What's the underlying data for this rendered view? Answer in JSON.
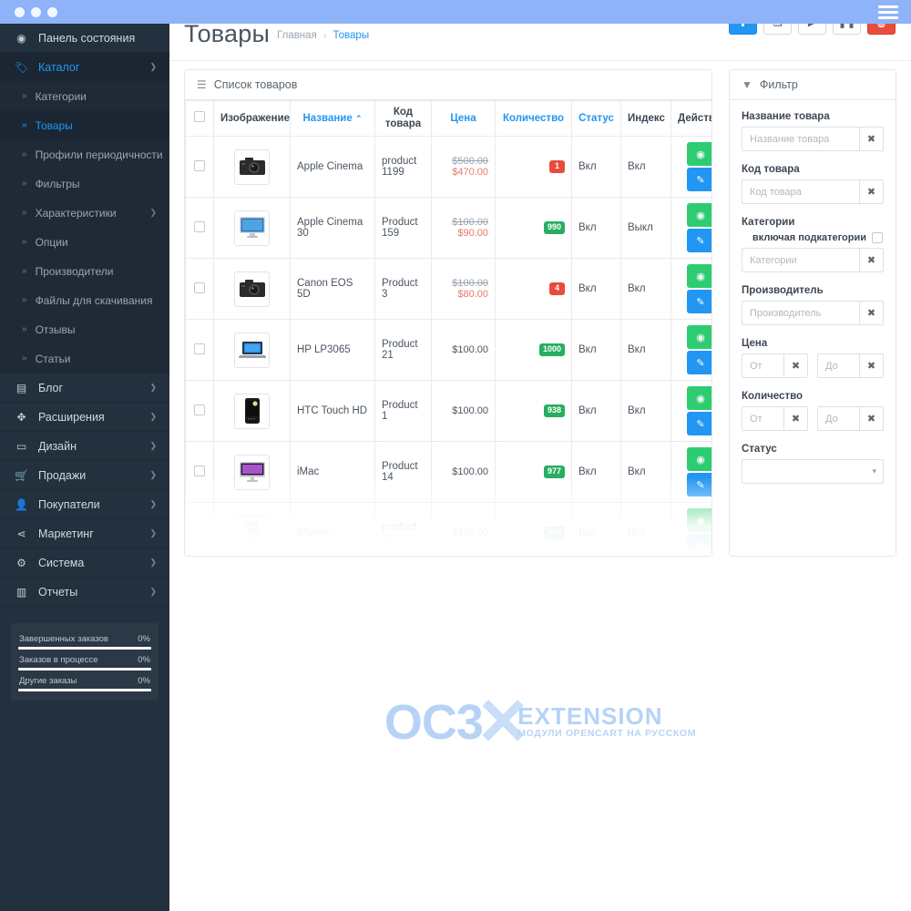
{
  "chrome": {
    "hamburger_icon": "hamburger-icon",
    "dots": [
      "dot",
      "dot",
      "dot"
    ]
  },
  "header": {
    "title": "Товары",
    "breadcrumb": {
      "home": "Главная",
      "separator": "›",
      "current": "Товары"
    }
  },
  "toolbar": {
    "buttons": [
      {
        "name": "add-new-button",
        "icon": "plus-icon",
        "glyph": "✚",
        "style": "primary"
      },
      {
        "name": "copy-button",
        "icon": "copy-icon",
        "glyph": "❏",
        "style": "default"
      },
      {
        "name": "enable-button",
        "icon": "play-icon",
        "glyph": "▶",
        "style": "default"
      },
      {
        "name": "disable-button",
        "icon": "pause-icon",
        "glyph": "❚❚",
        "style": "default"
      },
      {
        "name": "delete-button",
        "icon": "trash-icon",
        "glyph": "🗑",
        "style": "danger"
      }
    ]
  },
  "sidebar": {
    "items": [
      {
        "label": "Панель состояния",
        "icon": "dashboard-icon",
        "glyph": "◉",
        "has_caret": false,
        "active": false,
        "level": 0
      },
      {
        "label": "Каталог",
        "icon": "tag-icon",
        "glyph": "🏷",
        "has_caret": true,
        "active": true,
        "level": 0
      },
      {
        "label": "Категории",
        "icon": "chevron-right-icon",
        "has_caret": false,
        "active": false,
        "level": 1
      },
      {
        "label": "Товары",
        "icon": "chevron-right-icon",
        "has_caret": false,
        "active": true,
        "level": 1
      },
      {
        "label": "Профили периодичности",
        "icon": "chevron-right-icon",
        "has_caret": false,
        "active": false,
        "level": 1
      },
      {
        "label": "Фильтры",
        "icon": "chevron-right-icon",
        "has_caret": false,
        "active": false,
        "level": 1
      },
      {
        "label": "Характеристики",
        "icon": "chevron-right-icon",
        "has_caret": true,
        "active": false,
        "level": 1
      },
      {
        "label": "Опции",
        "icon": "chevron-right-icon",
        "has_caret": false,
        "active": false,
        "level": 1
      },
      {
        "label": "Производители",
        "icon": "chevron-right-icon",
        "has_caret": false,
        "active": false,
        "level": 1
      },
      {
        "label": "Файлы для скачивания",
        "icon": "chevron-right-icon",
        "has_caret": false,
        "active": false,
        "level": 1
      },
      {
        "label": "Отзывы",
        "icon": "chevron-right-icon",
        "has_caret": false,
        "active": false,
        "level": 1
      },
      {
        "label": "Статьи",
        "icon": "chevron-right-icon",
        "has_caret": false,
        "active": false,
        "level": 1
      },
      {
        "label": "Блог",
        "icon": "book-icon",
        "glyph": "▤",
        "has_caret": true,
        "active": false,
        "level": 0
      },
      {
        "label": "Расширения",
        "icon": "puzzle-icon",
        "glyph": "✥",
        "has_caret": true,
        "active": false,
        "level": 0
      },
      {
        "label": "Дизайн",
        "icon": "monitor-icon",
        "glyph": "▭",
        "has_caret": true,
        "active": false,
        "level": 0
      },
      {
        "label": "Продажи",
        "icon": "cart-icon",
        "glyph": "🛒",
        "has_caret": true,
        "active": false,
        "level": 0
      },
      {
        "label": "Покупатели",
        "icon": "user-icon",
        "glyph": "👤",
        "has_caret": true,
        "active": false,
        "level": 0
      },
      {
        "label": "Маркетинг",
        "icon": "share-icon",
        "glyph": "⋖",
        "has_caret": true,
        "active": false,
        "level": 0
      },
      {
        "label": "Система",
        "icon": "gear-icon",
        "glyph": "⚙",
        "has_caret": true,
        "active": false,
        "level": 0
      },
      {
        "label": "Отчеты",
        "icon": "chart-bar-icon",
        "glyph": "▥",
        "has_caret": true,
        "active": false,
        "level": 0
      }
    ],
    "stats": [
      {
        "label": "Завершенных заказов",
        "value": "0%",
        "percent": 100
      },
      {
        "label": "Заказов в процессе",
        "value": "0%",
        "percent": 100
      },
      {
        "label": "Другие заказы",
        "value": "0%",
        "percent": 100
      }
    ]
  },
  "products_panel": {
    "title": "Список товаров",
    "icon": "list-icon",
    "columns": [
      {
        "label": "",
        "blue": false,
        "name": "select-all"
      },
      {
        "label": "Изображение",
        "blue": false,
        "name": "image"
      },
      {
        "label": "Название",
        "blue": true,
        "name": "name",
        "sorted": "asc",
        "sort_arrow": "⌃"
      },
      {
        "label": "Код товара",
        "blue": false,
        "name": "model"
      },
      {
        "label": "Цена",
        "blue": true,
        "name": "price"
      },
      {
        "label": "Количество",
        "blue": true,
        "name": "quantity"
      },
      {
        "label": "Статус",
        "blue": true,
        "name": "status"
      },
      {
        "label": "Индекс",
        "blue": false,
        "name": "index"
      },
      {
        "label": "Действие",
        "blue": false,
        "name": "action"
      }
    ],
    "rows": [
      {
        "image": "camera",
        "name": "Apple Cinema",
        "code": "product 1199",
        "price_old": "$500.00",
        "price_new": "$470.00",
        "price": "",
        "qty": "1",
        "qty_color": "red",
        "status": "Вкл",
        "index": "Вкл"
      },
      {
        "image": "monitor",
        "name": "Apple Cinema 30",
        "code": "Product 159",
        "price_old": "$100.00",
        "price_new": "$90.00",
        "price": "",
        "qty": "990",
        "qty_color": "green",
        "status": "Вкл",
        "index": "Выкл"
      },
      {
        "image": "camera",
        "name": "Canon EOS 5D",
        "code": "Product 3",
        "price_old": "$100.00",
        "price_new": "$80.00",
        "price": "",
        "qty": "4",
        "qty_color": "red",
        "status": "Вкл",
        "index": "Вкл"
      },
      {
        "image": "laptop",
        "name": "HP LP3065",
        "code": "Product 21",
        "price_old": "",
        "price_new": "",
        "price": "$100.00",
        "qty": "1000",
        "qty_color": "green",
        "status": "Вкл",
        "index": "Вкл"
      },
      {
        "image": "phone",
        "name": "HTC Touch HD",
        "code": "Product 1",
        "price_old": "",
        "price_new": "",
        "price": "$100.00",
        "qty": "938",
        "qty_color": "green",
        "status": "Вкл",
        "index": "Вкл"
      },
      {
        "image": "imac",
        "name": "iMac",
        "code": "Product 14",
        "price_old": "",
        "price_new": "",
        "price": "$100.00",
        "qty": "977",
        "qty_color": "green",
        "status": "Вкл",
        "index": "Вкл"
      },
      {
        "image": "ipod",
        "name": "iPhone",
        "code": "product 11",
        "price_old": "",
        "price_new": "",
        "price": "$100.00",
        "qty": "968",
        "qty_color": "green",
        "status": "Вкл",
        "index": "Вкл"
      }
    ],
    "action_buttons": {
      "view_icon": "eye-icon",
      "view_glyph": "👁",
      "edit_icon": "pencil-icon",
      "edit_glyph": "✎"
    }
  },
  "filter_panel": {
    "title": "Фильтр",
    "icon": "funnel-icon",
    "groups": [
      {
        "label": "Название товара",
        "placeholder": "Название товара",
        "value": "",
        "name": "filter-product-name",
        "type": "text"
      },
      {
        "label": "Код товара",
        "placeholder": "Код товара",
        "value": "",
        "name": "filter-product-code",
        "type": "text"
      },
      {
        "label": "Категории",
        "placeholder": "Категории",
        "value": "",
        "name": "filter-category",
        "type": "text",
        "sublabel": "включая подкатегории",
        "checkbox": true
      },
      {
        "label": "Производитель",
        "placeholder": "Производитель",
        "value": "",
        "name": "filter-manufacturer",
        "type": "text"
      },
      {
        "label": "Цена",
        "placeholder_from": "От",
        "placeholder_to": "До",
        "value": "",
        "name": "filter-price",
        "type": "range"
      },
      {
        "label": "Количество",
        "placeholder_from": "От",
        "placeholder_to": "До",
        "value": "",
        "name": "filter-quantity",
        "type": "range"
      },
      {
        "label": "Статус",
        "placeholder": "",
        "value": "",
        "name": "filter-status",
        "type": "select"
      }
    ],
    "clear_icon": "clear-x-icon",
    "clear_glyph": "✖"
  },
  "watermark": {
    "brand": "OC3",
    "x": "✕",
    "extension": "EXTENSION",
    "tagline": "МОДУЛИ OPENCART НА РУССКОМ"
  },
  "colors": {
    "chrome_blue": "#8fb3f8",
    "sidebar_bg": "#23303e",
    "accent_blue": "#2196f3",
    "danger_red": "#e74c3c",
    "success_green": "#2ecc71",
    "badge_green": "#27ae60",
    "price_sale": "#e8796b"
  }
}
